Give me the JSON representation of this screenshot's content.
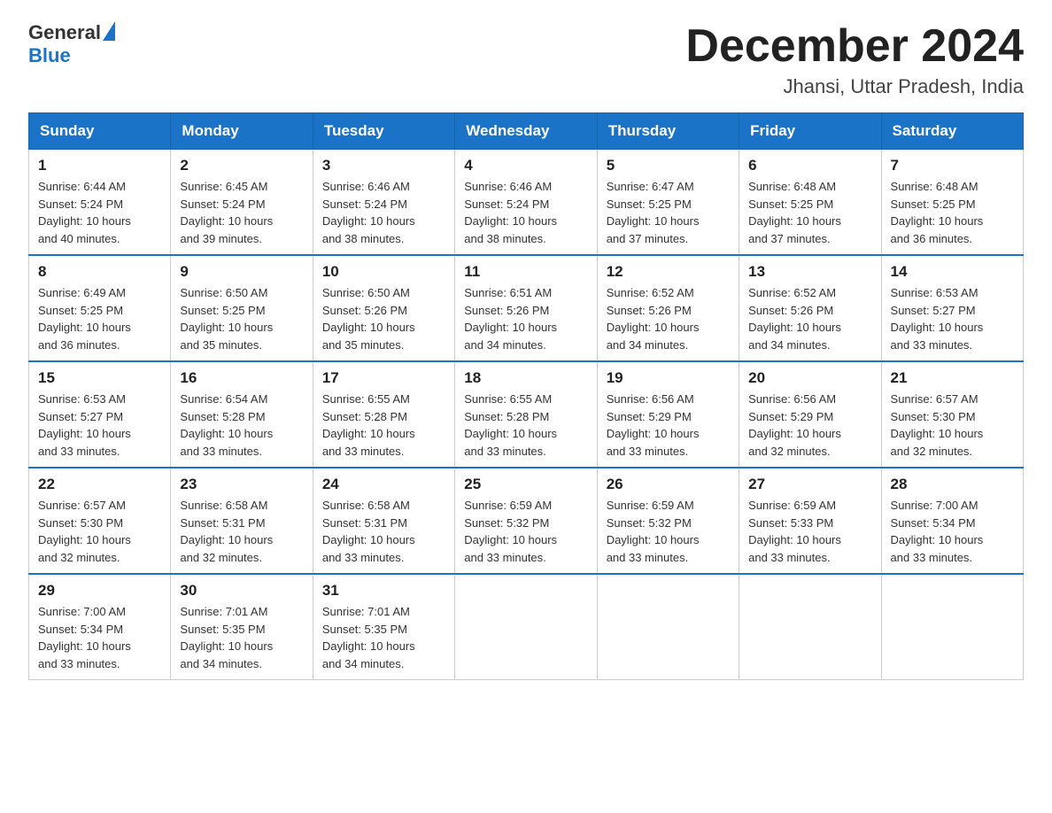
{
  "header": {
    "logo_general": "General",
    "logo_blue": "Blue",
    "month_title": "December 2024",
    "location": "Jhansi, Uttar Pradesh, India"
  },
  "days_of_week": [
    "Sunday",
    "Monday",
    "Tuesday",
    "Wednesday",
    "Thursday",
    "Friday",
    "Saturday"
  ],
  "weeks": [
    [
      {
        "day": "1",
        "info": "Sunrise: 6:44 AM\nSunset: 5:24 PM\nDaylight: 10 hours\nand 40 minutes."
      },
      {
        "day": "2",
        "info": "Sunrise: 6:45 AM\nSunset: 5:24 PM\nDaylight: 10 hours\nand 39 minutes."
      },
      {
        "day": "3",
        "info": "Sunrise: 6:46 AM\nSunset: 5:24 PM\nDaylight: 10 hours\nand 38 minutes."
      },
      {
        "day": "4",
        "info": "Sunrise: 6:46 AM\nSunset: 5:24 PM\nDaylight: 10 hours\nand 38 minutes."
      },
      {
        "day": "5",
        "info": "Sunrise: 6:47 AM\nSunset: 5:25 PM\nDaylight: 10 hours\nand 37 minutes."
      },
      {
        "day": "6",
        "info": "Sunrise: 6:48 AM\nSunset: 5:25 PM\nDaylight: 10 hours\nand 37 minutes."
      },
      {
        "day": "7",
        "info": "Sunrise: 6:48 AM\nSunset: 5:25 PM\nDaylight: 10 hours\nand 36 minutes."
      }
    ],
    [
      {
        "day": "8",
        "info": "Sunrise: 6:49 AM\nSunset: 5:25 PM\nDaylight: 10 hours\nand 36 minutes."
      },
      {
        "day": "9",
        "info": "Sunrise: 6:50 AM\nSunset: 5:25 PM\nDaylight: 10 hours\nand 35 minutes."
      },
      {
        "day": "10",
        "info": "Sunrise: 6:50 AM\nSunset: 5:26 PM\nDaylight: 10 hours\nand 35 minutes."
      },
      {
        "day": "11",
        "info": "Sunrise: 6:51 AM\nSunset: 5:26 PM\nDaylight: 10 hours\nand 34 minutes."
      },
      {
        "day": "12",
        "info": "Sunrise: 6:52 AM\nSunset: 5:26 PM\nDaylight: 10 hours\nand 34 minutes."
      },
      {
        "day": "13",
        "info": "Sunrise: 6:52 AM\nSunset: 5:26 PM\nDaylight: 10 hours\nand 34 minutes."
      },
      {
        "day": "14",
        "info": "Sunrise: 6:53 AM\nSunset: 5:27 PM\nDaylight: 10 hours\nand 33 minutes."
      }
    ],
    [
      {
        "day": "15",
        "info": "Sunrise: 6:53 AM\nSunset: 5:27 PM\nDaylight: 10 hours\nand 33 minutes."
      },
      {
        "day": "16",
        "info": "Sunrise: 6:54 AM\nSunset: 5:28 PM\nDaylight: 10 hours\nand 33 minutes."
      },
      {
        "day": "17",
        "info": "Sunrise: 6:55 AM\nSunset: 5:28 PM\nDaylight: 10 hours\nand 33 minutes."
      },
      {
        "day": "18",
        "info": "Sunrise: 6:55 AM\nSunset: 5:28 PM\nDaylight: 10 hours\nand 33 minutes."
      },
      {
        "day": "19",
        "info": "Sunrise: 6:56 AM\nSunset: 5:29 PM\nDaylight: 10 hours\nand 33 minutes."
      },
      {
        "day": "20",
        "info": "Sunrise: 6:56 AM\nSunset: 5:29 PM\nDaylight: 10 hours\nand 32 minutes."
      },
      {
        "day": "21",
        "info": "Sunrise: 6:57 AM\nSunset: 5:30 PM\nDaylight: 10 hours\nand 32 minutes."
      }
    ],
    [
      {
        "day": "22",
        "info": "Sunrise: 6:57 AM\nSunset: 5:30 PM\nDaylight: 10 hours\nand 32 minutes."
      },
      {
        "day": "23",
        "info": "Sunrise: 6:58 AM\nSunset: 5:31 PM\nDaylight: 10 hours\nand 32 minutes."
      },
      {
        "day": "24",
        "info": "Sunrise: 6:58 AM\nSunset: 5:31 PM\nDaylight: 10 hours\nand 33 minutes."
      },
      {
        "day": "25",
        "info": "Sunrise: 6:59 AM\nSunset: 5:32 PM\nDaylight: 10 hours\nand 33 minutes."
      },
      {
        "day": "26",
        "info": "Sunrise: 6:59 AM\nSunset: 5:32 PM\nDaylight: 10 hours\nand 33 minutes."
      },
      {
        "day": "27",
        "info": "Sunrise: 6:59 AM\nSunset: 5:33 PM\nDaylight: 10 hours\nand 33 minutes."
      },
      {
        "day": "28",
        "info": "Sunrise: 7:00 AM\nSunset: 5:34 PM\nDaylight: 10 hours\nand 33 minutes."
      }
    ],
    [
      {
        "day": "29",
        "info": "Sunrise: 7:00 AM\nSunset: 5:34 PM\nDaylight: 10 hours\nand 33 minutes."
      },
      {
        "day": "30",
        "info": "Sunrise: 7:01 AM\nSunset: 5:35 PM\nDaylight: 10 hours\nand 34 minutes."
      },
      {
        "day": "31",
        "info": "Sunrise: 7:01 AM\nSunset: 5:35 PM\nDaylight: 10 hours\nand 34 minutes."
      },
      {
        "day": "",
        "info": ""
      },
      {
        "day": "",
        "info": ""
      },
      {
        "day": "",
        "info": ""
      },
      {
        "day": "",
        "info": ""
      }
    ]
  ]
}
